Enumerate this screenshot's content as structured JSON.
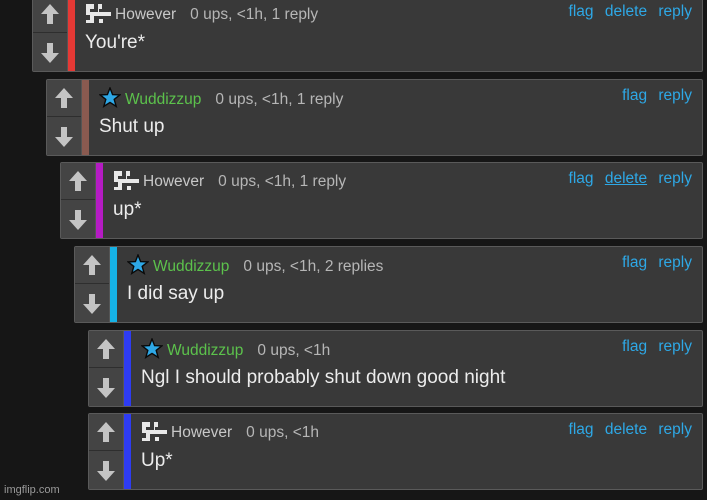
{
  "colors": {
    "link": "#2ea8e6",
    "username_green": "#5cc24c",
    "bar_red": "#e53935",
    "bar_brown": "#8a5a50",
    "bar_magenta": "#b51bc4",
    "bar_cyan": "#16b2e6",
    "bar_blue": "#2e3cf2"
  },
  "vote_icons": {
    "up": "up-arrow-icon",
    "down": "down-arrow-icon"
  },
  "comments": [
    {
      "username": "However",
      "avatar": "pinwheel-icon",
      "meta": "0 ups, <1h, 1 reply",
      "actions": [
        "flag",
        "delete",
        "reply"
      ],
      "text": "You're*"
    },
    {
      "username": "Wuddizzup",
      "avatar": "star-icon",
      "meta": "0 ups, <1h, 1 reply",
      "actions": [
        "flag",
        "reply"
      ],
      "text": "Shut up"
    },
    {
      "username": "However",
      "avatar": "pinwheel-icon",
      "meta": "0 ups, <1h, 1 reply",
      "actions": [
        "flag",
        "delete",
        "reply"
      ],
      "text": "up*"
    },
    {
      "username": "Wuddizzup",
      "avatar": "star-icon",
      "meta": "0 ups, <1h, 2 replies",
      "actions": [
        "flag",
        "reply"
      ],
      "text": "I did say up"
    },
    {
      "username": "Wuddizzup",
      "avatar": "star-icon",
      "meta": "0 ups, <1h",
      "actions": [
        "flag",
        "reply"
      ],
      "text": "Ngl I should probably shut down good night"
    },
    {
      "username": "However",
      "avatar": "pinwheel-icon",
      "meta": "0 ups, <1h",
      "actions": [
        "flag",
        "delete",
        "reply"
      ],
      "text": "Up*"
    }
  ],
  "watermark": "imgflip.com"
}
